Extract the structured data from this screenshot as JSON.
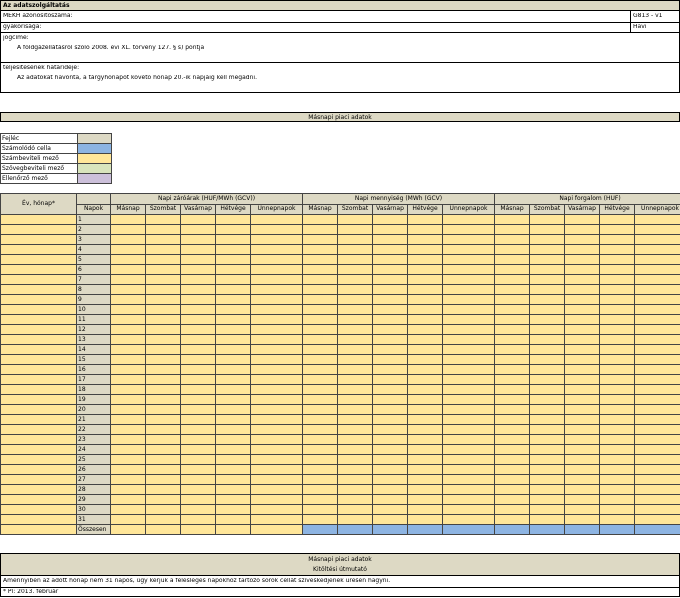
{
  "header": {
    "title": "Az adatszolgáltatás",
    "mekh_label": "MEKH azonosítószáma:",
    "mekh_value": "G813 - v1",
    "freq_label": "gyakorisága:",
    "freq_value": "Havi",
    "legal_label": "jogcíme:",
    "legal_value": "A földgázellátásról szóló 2008. évi XL. törvény 127. § s) pontja",
    "deadline_label": "teljesítésének határideje:",
    "deadline_value": "Az adatokat havonta, a tárgyhónapot követő hónap 20.-ik napjáig kell megadni."
  },
  "section_title": "Másnapi piaci adatok",
  "legend": {
    "header": "Fejléc",
    "items": [
      {
        "label": "Számolódó cella",
        "color": "#8db4e2"
      },
      {
        "label": "Számbeviteli mező",
        "color": "#ffe699"
      },
      {
        "label": "Szövegbeviteli mező",
        "color": "#d8e4bc"
      },
      {
        "label": "Ellenőrző mező",
        "color": "#ccc0da"
      }
    ]
  },
  "table": {
    "year_month_header": "Év, hónap*",
    "napok_header": "Napok",
    "groups": [
      "Napi záróárak (HUF/MWh (GCV))",
      "Napi mennyiség (MWh (GCV)",
      "Napi forgalom (HUF)"
    ],
    "subheaders": [
      "Másnap",
      "Szombat",
      "Vasárnap",
      "Hétvége",
      "Ünnepnapok"
    ],
    "days": [
      "1",
      "2",
      "3",
      "4",
      "5",
      "6",
      "7",
      "8",
      "9",
      "10",
      "11",
      "12",
      "13",
      "14",
      "15",
      "16",
      "17",
      "18",
      "19",
      "20",
      "21",
      "22",
      "23",
      "24",
      "25",
      "26",
      "27",
      "28",
      "29",
      "30",
      "31"
    ],
    "total_label": "Összesen"
  },
  "footer": {
    "title": "Másnapi piaci adatok",
    "subtitle": "Kitöltési útmutató",
    "note": "Amennyiben az adott hónap nem 31 napos, úgy kérjük a felesleges napokhoz tartozó sorok cellát szíveskedjenek üresen hagyni.",
    "example": "* Pl: 2013. február"
  },
  "colors": {
    "header": "#ddd9c4",
    "input": "#ffe699",
    "calc": "#8db4e2",
    "text": "#d8e4bc",
    "check": "#ccc0da"
  }
}
